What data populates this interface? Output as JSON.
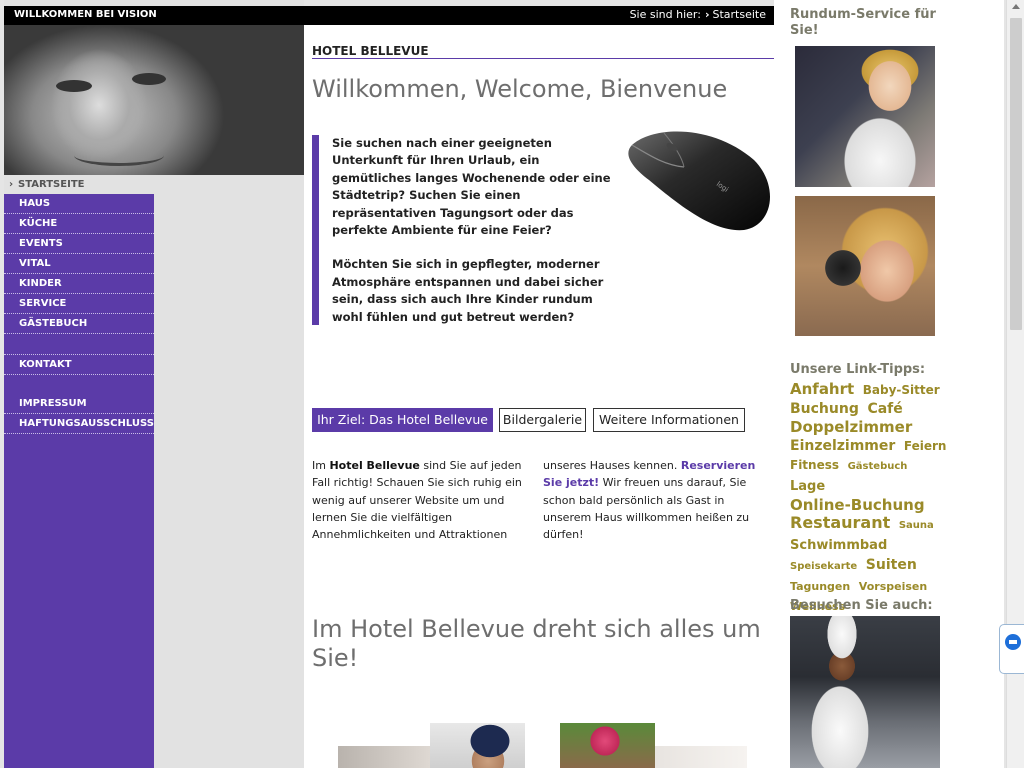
{
  "topbar": {
    "brand": "WILLKOMMEN BEI VISION",
    "breadcrumb_prefix": "Sie sind hier:",
    "breadcrumb_current": "Startseite"
  },
  "nav": {
    "current": "STARTSEITE",
    "items_primary": [
      "HAUS",
      "KÜCHE",
      "EVENTS",
      "VITAL",
      "KINDER",
      "SERVICE",
      "GÄSTEBUCH"
    ],
    "items_secondary": [
      "KONTAKT",
      "IMPRESSUM",
      "HAFTUNGSAUSSCHLUSS"
    ]
  },
  "main": {
    "hotel_title": "HOTEL BELLEVUE",
    "welcome_heading": "Willkommen, Welcome, Bienvenue",
    "quote_p1": "Sie suchen nach einer geeigneten Unterkunft für Ihren Urlaub, ein gemütliches langes Wochenende oder eine Städtetrip? Suchen Sie einen repräsentativen Tagungsort oder das perfekte Ambiente für eine Feier?",
    "quote_p2": "Möchten Sie sich in gepflegter, moderner Atmosphäre entspannen und dabei sicher sein, dass sich auch Ihre Kinder rundum wohl fühlen und gut betreut werden?",
    "tabs": [
      "Ihr Ziel: Das Hotel Bellevue",
      "Bildergalerie",
      "Weitere Informationen"
    ],
    "intro_pre": "Im ",
    "intro_bold": "Hotel Bellevue",
    "intro_rest": " sind Sie auf jeden Fall richtig! Schauen Sie sich ruhig ein wenig auf unserer Website um und lernen Sie die vielfältigen Annehmlichkeiten und Attraktionen",
    "col2_pre": "unseres Hauses kennen. ",
    "col2_link": "Reservieren Sie jetzt!",
    "col2_rest": " Wir freuen uns darauf, Sie schon bald persönlich als Gast in unserem Haus willkommen heißen zu dürfen!",
    "tagline": "Im Hotel Bellevue dreht sich alles um Sie!"
  },
  "right": {
    "rundum_title": "Rundum-Service für Sie!",
    "links_title": "Unsere Link-Tipps:",
    "tags": [
      {
        "label": "Anfahrt",
        "size": 15
      },
      {
        "label": "Baby-Sitter",
        "size": 12
      },
      {
        "label": "Buchung",
        "size": 14
      },
      {
        "label": "Café",
        "size": 14
      },
      {
        "label": "Doppelzimmer",
        "size": 15
      },
      {
        "label": "Einzelzimmer",
        "size": 14
      },
      {
        "label": "Feiern",
        "size": 12
      },
      {
        "label": "Fitness",
        "size": 12
      },
      {
        "label": "Gästebuch",
        "size": 10
      },
      {
        "label": "Lage",
        "size": 13
      },
      {
        "label": "Online-Buchung",
        "size": 15
      },
      {
        "label": "Restaurant",
        "size": 16
      },
      {
        "label": "Sauna",
        "size": 10
      },
      {
        "label": "Schwimmbad",
        "size": 13
      },
      {
        "label": "Speisekarte",
        "size": 10
      },
      {
        "label": "Suiten",
        "size": 14
      },
      {
        "label": "Tagungen",
        "size": 11
      },
      {
        "label": "Vorspeisen",
        "size": 11
      },
      {
        "label": "Wellness",
        "size": 11
      }
    ],
    "besuch_title": "Besuchen Sie auch:"
  },
  "colors": {
    "accent": "#5b3ba8",
    "tag": "#9a8a28",
    "heading_gray": "#6e6e6e"
  }
}
